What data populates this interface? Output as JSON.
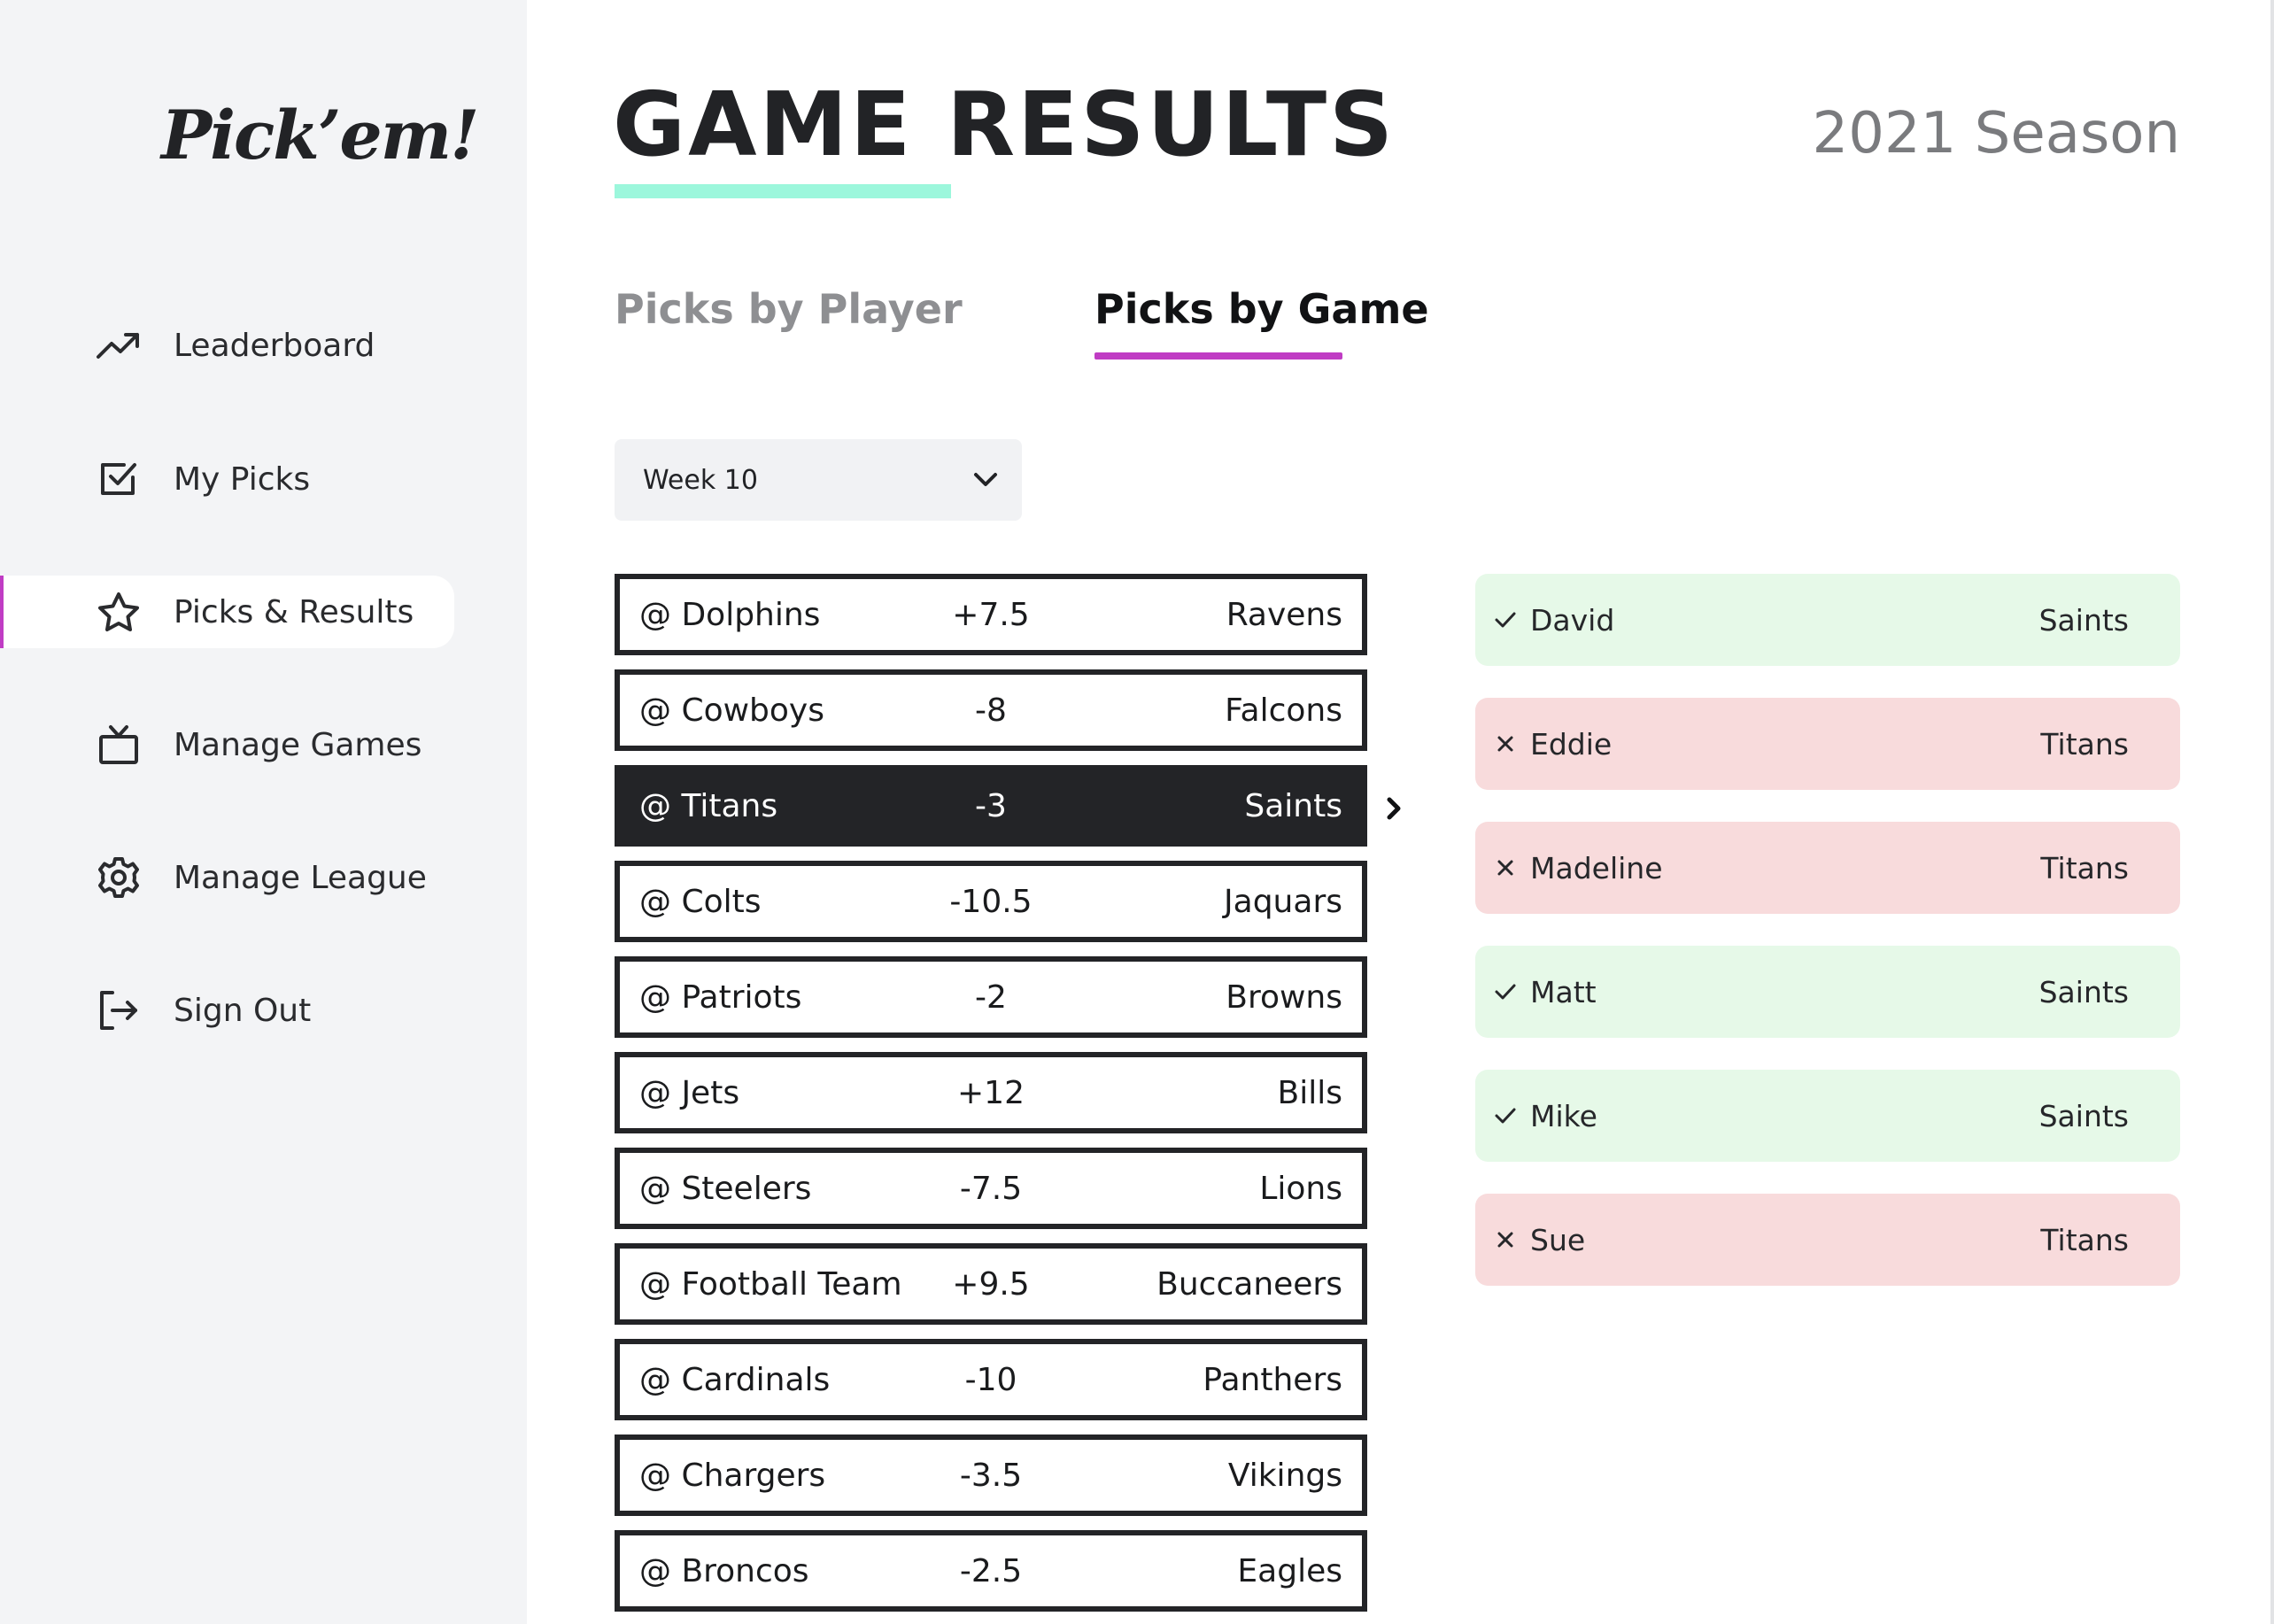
{
  "app": {
    "logo": "Pick’em!"
  },
  "sidebar": {
    "items": [
      {
        "label": "Leaderboard",
        "icon": "trending-up-icon",
        "active": false
      },
      {
        "label": "My Picks",
        "icon": "checkbox-icon",
        "active": false
      },
      {
        "label": "Picks & Results",
        "icon": "star-icon",
        "active": true
      },
      {
        "label": "Manage Games",
        "icon": "tv-icon",
        "active": false
      },
      {
        "label": "Manage League",
        "icon": "gear-icon",
        "active": false
      },
      {
        "label": "Sign Out",
        "icon": "sign-out-icon",
        "active": false
      }
    ]
  },
  "header": {
    "title": "GAME RESULTS",
    "season": "2021 Season"
  },
  "tabs": [
    {
      "label": "Picks by Player",
      "active": false
    },
    {
      "label": "Picks by Game",
      "active": true
    }
  ],
  "week_select": {
    "value": "Week 10"
  },
  "games": [
    {
      "home": "@ Dolphins",
      "spread": "+7.5",
      "away": "Ravens",
      "selected": false
    },
    {
      "home": "@ Cowboys",
      "spread": "-8",
      "away": "Falcons",
      "selected": false
    },
    {
      "home": "@ Titans",
      "spread": "-3",
      "away": "Saints",
      "selected": true
    },
    {
      "home": "@ Colts",
      "spread": "-10.5",
      "away": "Jaquars",
      "selected": false
    },
    {
      "home": "@ Patriots",
      "spread": "-2",
      "away": "Browns",
      "selected": false
    },
    {
      "home": "@ Jets",
      "spread": "+12",
      "away": "Bills",
      "selected": false
    },
    {
      "home": "@ Steelers",
      "spread": "-7.5",
      "away": "Lions",
      "selected": false
    },
    {
      "home": "@ Football Team",
      "spread": "+9.5",
      "away": "Buccaneers",
      "selected": false
    },
    {
      "home": "@ Cardinals",
      "spread": "-10",
      "away": "Panthers",
      "selected": false
    },
    {
      "home": "@ Chargers",
      "spread": "-3.5",
      "away": "Vikings",
      "selected": false
    },
    {
      "home": "@ Broncos",
      "spread": "-2.5",
      "away": "Eagles",
      "selected": false
    }
  ],
  "picks": [
    {
      "player": "David",
      "team": "Saints",
      "result": "correct",
      "icon": "check-icon"
    },
    {
      "player": "Eddie",
      "team": "Titans",
      "result": "wrong",
      "icon": "x-icon"
    },
    {
      "player": "Madeline",
      "team": "Titans",
      "result": "wrong",
      "icon": "x-icon"
    },
    {
      "player": "Matt",
      "team": "Saints",
      "result": "correct",
      "icon": "check-icon"
    },
    {
      "player": "Mike",
      "team": "Saints",
      "result": "correct",
      "icon": "check-icon"
    },
    {
      "player": "Sue",
      "team": "Titans",
      "result": "wrong",
      "icon": "x-icon"
    }
  ],
  "colors": {
    "accent": "#c03cc4",
    "title_underline": "#9cf7dc",
    "correct_bg": "#e6f9e8",
    "wrong_bg": "#f8dbdc",
    "selected_game_bg": "#232427"
  }
}
